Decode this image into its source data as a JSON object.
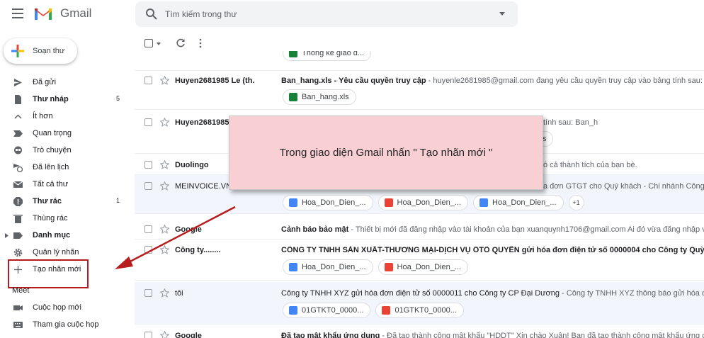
{
  "header": {
    "app_name": "Gmail",
    "search_placeholder": "Tìm kiếm trong thư"
  },
  "compose": {
    "label": "Soạn thư"
  },
  "sidebar": {
    "items": [
      {
        "label": "Đã gửi",
        "icon": "send-icon",
        "count": "",
        "bold": false
      },
      {
        "label": "Thư nháp",
        "icon": "draft-icon",
        "count": "5",
        "bold": true
      },
      {
        "label": "Ít hơn",
        "icon": "chevron-up-icon",
        "count": "",
        "bold": false
      },
      {
        "label": "Quan trọng",
        "icon": "important-icon",
        "count": "",
        "bold": false
      },
      {
        "label": "Trò chuyện",
        "icon": "chat-icon",
        "count": "",
        "bold": false
      },
      {
        "label": "Đã lên lịch",
        "icon": "schedule-icon",
        "count": "",
        "bold": false
      },
      {
        "label": "Tất cả thư",
        "icon": "mail-icon",
        "count": "",
        "bold": false
      },
      {
        "label": "Thư rác",
        "icon": "spam-icon",
        "count": "1",
        "bold": true
      },
      {
        "label": "Thùng rác",
        "icon": "trash-icon",
        "count": "",
        "bold": false
      },
      {
        "label": "Danh mục",
        "icon": "category-icon",
        "count": "",
        "bold": true
      },
      {
        "label": "Quản lý nhãn",
        "icon": "gear-icon",
        "count": "",
        "bold": false
      },
      {
        "label": "Tạo nhãn mới",
        "icon": "plus-icon",
        "count": "",
        "bold": false
      }
    ],
    "meet_title": "Meet",
    "meet_items": [
      {
        "label": "Cuộc họp mới",
        "icon": "video-icon"
      },
      {
        "label": "Tham gia cuộc họp",
        "icon": "keyboard-icon"
      }
    ]
  },
  "mails": [
    {
      "sender": "",
      "subject": "",
      "snippet": "",
      "chips": [
        "Thống kê giao d..."
      ],
      "chip_types": [
        "xls"
      ],
      "more": ""
    },
    {
      "sender": "Huyen2681985 Le (th.",
      "subject": "Ban_hang.xls - Yêu cầu quyền truy cập",
      "snippet": " - huyenle2681985@gmail.com đang yêu cầu quyền truy cập vào bảng tính sau: Ban_h",
      "chips": [
        "Ban_hang.xls"
      ],
      "chip_types": [
        "xls"
      ],
      "more": ""
    },
    {
      "sender": "Huyen2681985",
      "subject": "",
      "snippet": "tính sau: Ban_h",
      "chips": [
        "s"
      ],
      "chip_types": [
        "plain"
      ],
      "more": ""
    },
    {
      "sender": "Duolingo",
      "subject": "",
      "snippet": "ó cả thành tích của bạn bè.",
      "chips": [],
      "chip_types": [],
      "more": ""
    },
    {
      "sender": "MEINVOICE.VN",
      "subject": "",
      "snippet": "a đơn GTGT cho Quý khách - Chi nhánh Công ty",
      "chips": [
        "Hoa_Don_Dien_...",
        "Hoa_Don_Dien_...",
        "Hoa_Don_Dien_..."
      ],
      "chip_types": [
        "doc",
        "pdf",
        "doc"
      ],
      "more": "+1"
    },
    {
      "sender": "Google",
      "subject": "Cảnh báo bảo mật",
      "snippet": " - Thiết bị mới đã đăng nhập vào tài khoản của bạn xuanquynh1706@gmail.com Ai đó vừa đăng nhập vào T",
      "chips": [],
      "chip_types": [],
      "more": ""
    },
    {
      "sender": "Công ty........",
      "subject": "CÔNG TY TNHH SẢN XUẤT-THƯƠNG MẠI-DỊCH VỤ ÔTÔ QUYỀN gửi hóa đơn điện tử số 0000004 cho Công ty Quỳnh Phương",
      "snippet": "",
      "chips": [
        "Hoa_Don_Dien_...",
        "Hoa_Don_Dien_..."
      ],
      "chip_types": [
        "doc",
        "pdf"
      ],
      "more": ""
    },
    {
      "sender": "tôi",
      "subject": "Công ty TNHH XYZ gửi hóa đơn điện tử số 0000011 cho Công ty CP Đại Dương",
      "snippet": " - Công ty TNHH XYZ thông báo gửi hóa đơn c",
      "chips": [
        "01GTKT0_0000...",
        "01GTKT0_0000..."
      ],
      "chip_types": [
        "doc",
        "pdf"
      ],
      "more": ""
    },
    {
      "sender": "Google",
      "subject": "Đã tạo mật khẩu ứng dụng",
      "snippet": " - Đã tạo thành công mật khẩu \"HDDT\" Xin chào Xuân! Bạn đã tạo thành công mật khẩu ứng dụng c",
      "chips": [],
      "chip_types": [],
      "more": ""
    }
  ],
  "annotation": {
    "text": "Trong giao diện Gmail nhấn \" Tạo nhãn mới \""
  },
  "colors": {
    "xls": "#188038",
    "doc": "#4285f4",
    "pdf": "#ea4335",
    "annotation_bg": "#f8d0d4",
    "highlight": "#b71c1c"
  }
}
